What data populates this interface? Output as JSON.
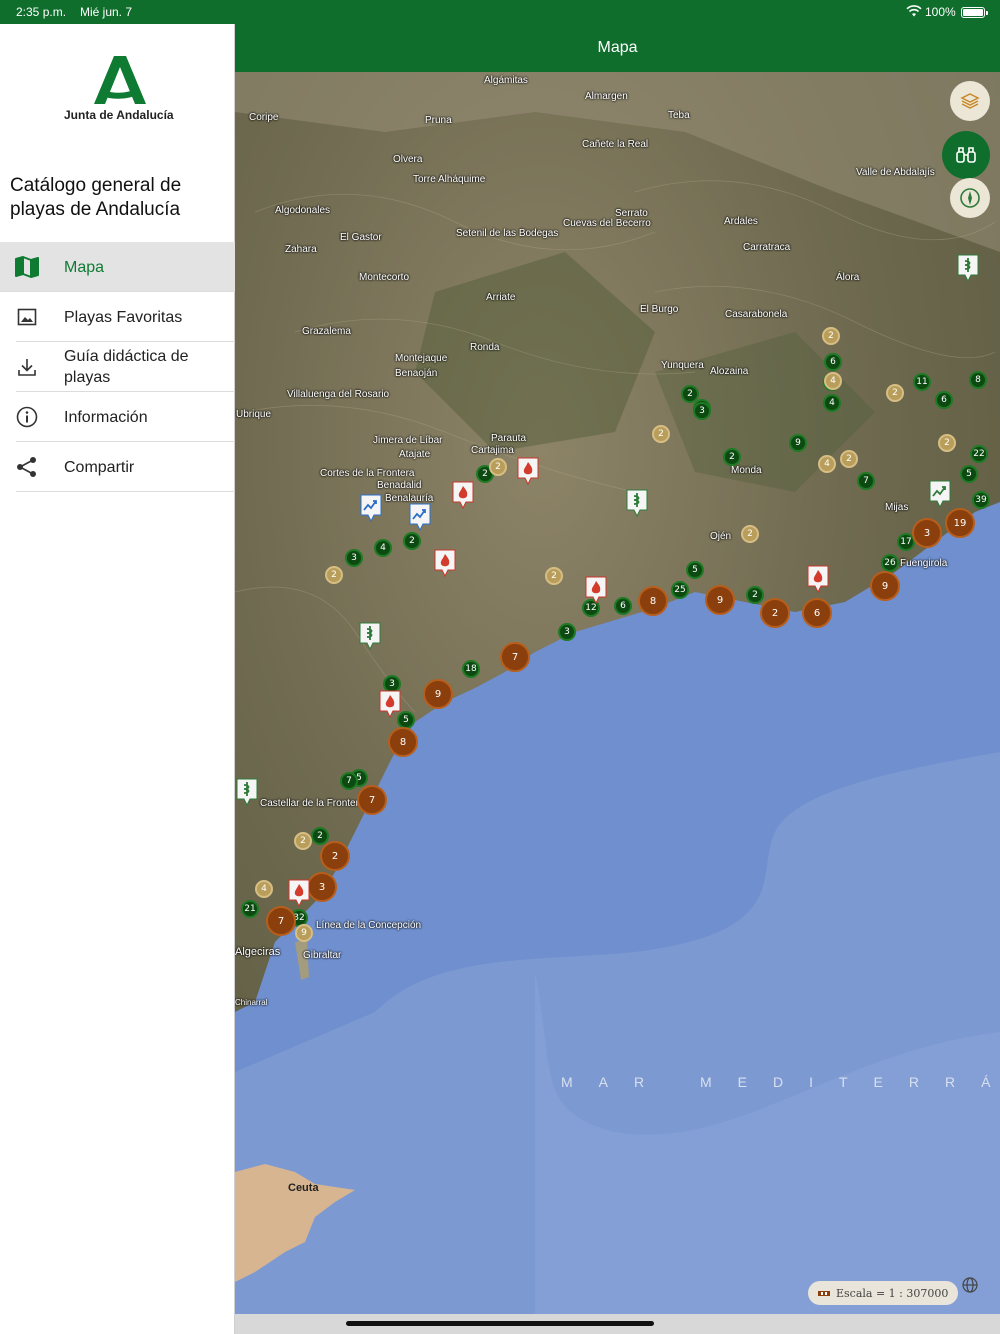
{
  "status": {
    "time": "2:35 p.m.",
    "date": "Mié jun. 7",
    "battery": "100%"
  },
  "sidebar": {
    "logo_text": "Junta de Andalucía",
    "app_title": "Catálogo general de playas de Andalucía",
    "items": [
      {
        "label": "Mapa",
        "icon": "map-icon",
        "active": true
      },
      {
        "label": "Playas Favoritas",
        "icon": "image-icon",
        "active": false
      },
      {
        "label": "Guía didáctica de playas",
        "icon": "download-icon",
        "active": false
      },
      {
        "label": "Información",
        "icon": "info-icon",
        "active": false
      },
      {
        "label": "Compartir",
        "icon": "share-icon",
        "active": false
      }
    ]
  },
  "header": {
    "title": "Mapa"
  },
  "map": {
    "places": [
      "Algámitas",
      "Almargen",
      "Teba",
      "Coripe",
      "Pruna",
      "Cañete la Real",
      "Olvera",
      "Torre Alháquime",
      "Valle de Abdalajís",
      "Algodonales",
      "Serrato",
      "Cuevas del Becerro",
      "Ardales",
      "Setenil de las Bodegas",
      "El Gastor",
      "Zahara",
      "Carratraca",
      "Montecorto",
      "Álora",
      "Arriate",
      "El Burgo",
      "Casarabonela",
      "Grazalema",
      "Ronda",
      "Montejaque",
      "Benaoján",
      "Yunquera",
      "Alozaina",
      "Villaluenga del Rosario",
      "Ubrique",
      "Parauta",
      "Jimera de Líbar",
      "Cartajima",
      "Atajate",
      "Cortes de la Frontera",
      "Benadalid",
      "Benalauría",
      "Monda",
      "Ojén",
      "Mijas",
      "Fuengirola",
      "Castellar de la Frontera",
      "Línea de la Concepción",
      "Algeciras",
      "Gibraltar",
      "Chinarral",
      "Ceuta",
      "MAR MEDITERRÁ"
    ],
    "sea_label": "MAR MEDITERRÁ",
    "scale_text": "Escala = 1 : 307000",
    "clusters_green": [
      "2",
      "3",
      "4",
      "2",
      "5",
      "3",
      "5",
      "7",
      "2",
      "4",
      "2",
      "6",
      "4",
      "2",
      "9",
      "2",
      "5",
      "3",
      "12",
      "6",
      "2",
      "7",
      "11",
      "8",
      "6",
      "22",
      "5",
      "39",
      "17",
      "26",
      "21",
      "32",
      "18",
      "25",
      "3"
    ],
    "clusters_tan": [
      "2",
      "2",
      "2",
      "4",
      "2",
      "2",
      "4",
      "2",
      "2",
      "2",
      "2",
      "2",
      "4",
      "9"
    ],
    "clusters_brown": [
      "7",
      "9",
      "8",
      "7",
      "2",
      "3",
      "7",
      "8",
      "9",
      "2",
      "6",
      "3",
      "19",
      "9"
    ]
  }
}
